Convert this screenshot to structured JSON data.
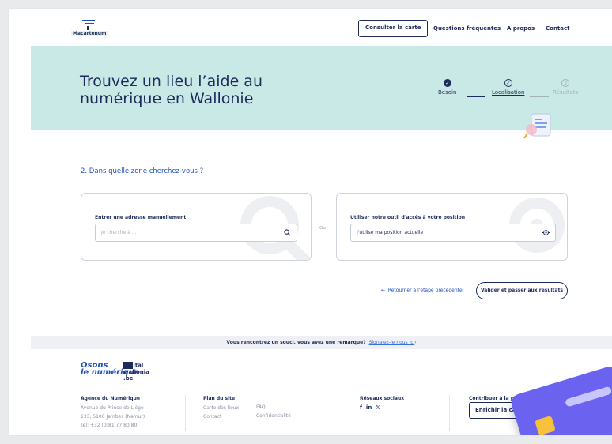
{
  "header": {
    "logo_text": "Macartenum",
    "consult_button": "Consulter la carte",
    "nav": [
      "Questions fréquentes",
      "A propos",
      "Contact"
    ]
  },
  "hero": {
    "title": "Trouvez un lieu l’aide au numérique en Wallonie",
    "steps": [
      {
        "label": "Besoin",
        "state": "done"
      },
      {
        "label": "Localisation",
        "state": "current"
      },
      {
        "label": "Résultats",
        "state": "todo",
        "number": "3"
      }
    ]
  },
  "form": {
    "question": "2. Dans quelle zone cherchez-vous ?",
    "manual": {
      "label": "Entrer une adresse manuellement",
      "placeholder": "Je cherche à ..."
    },
    "separator": "Ou",
    "geo": {
      "label": "Utiliser notre outil d'accès à votre position",
      "value": "J'utilise ma position actuelle"
    },
    "back_link": "Retourner à l'étape précédente",
    "validate_button": "Valider et passer aux résultats"
  },
  "feedback": {
    "text": "Vous rencontrez un souci, vous avez une remarque?",
    "link": "Signalez-le nous ici"
  },
  "footer": {
    "logo1_line1": "Osons",
    "logo1_line2": "le numérique",
    "logo2_line1": "digital",
    "logo2_line2": "wallonia",
    "logo2_line3": ".be",
    "agency": {
      "heading": "Agence du Numérique",
      "lines": [
        "Avenue du Prince de Liège",
        "133, 5100 Jambes (Namur)",
        "Tel: +32 (0)81 77 80 80"
      ]
    },
    "sitemap": {
      "heading": "Plan du site",
      "col1": [
        "Carte des lieux",
        "Contact"
      ],
      "col2": [
        "FAQ",
        "Confidentialité"
      ]
    },
    "social": {
      "heading": "Réseaux sociaux",
      "icons": [
        "f",
        "in",
        "𝕏"
      ]
    },
    "contribute": {
      "heading": "Contribuer à la plateforme",
      "button": "Enrichir la carte"
    }
  },
  "colors": {
    "navy": "#1d2b5b",
    "hero_bg": "#c9e9e6",
    "link_blue": "#1e4fbf",
    "card_purple": "#6b63f0"
  }
}
